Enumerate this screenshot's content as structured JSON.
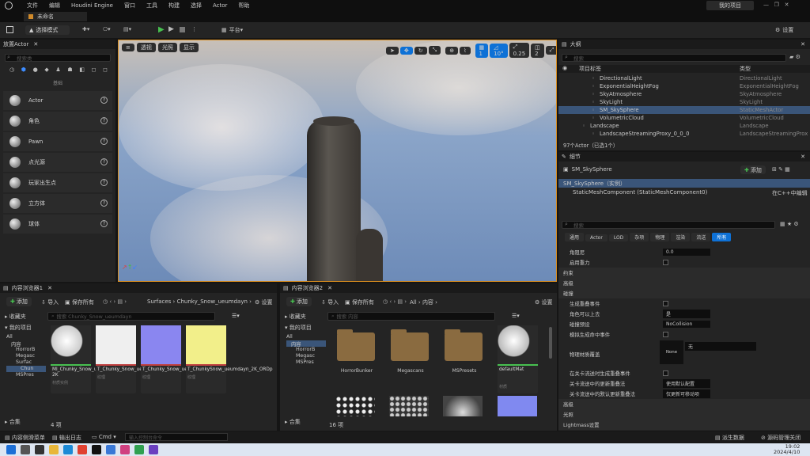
{
  "menu": {
    "items": [
      "文件",
      "编辑",
      "Houdini Engine",
      "窗口",
      "工具",
      "构建",
      "选择",
      "Actor",
      "帮助"
    ],
    "project": "我的项目"
  },
  "tab": {
    "title": "未命名"
  },
  "toolbar": {
    "select_mode": "选择模式",
    "platform": "平台",
    "settings": "设置"
  },
  "place_actor": {
    "title": "放置Actor",
    "search": "搜索类",
    "basic": "基础",
    "items": [
      "Actor",
      "角色",
      "Pawn",
      "点光源",
      "玩家出生点",
      "立方体",
      "球体"
    ]
  },
  "viewport": {
    "btns": [
      "透视",
      "光照",
      "显示"
    ],
    "grid_val": "1",
    "angle_val": "10°",
    "scale_val": "0.25",
    "cam_val": "2"
  },
  "outliner": {
    "title": "大纲",
    "search": "搜索",
    "col_label": "项目标签",
    "col_type": "类型",
    "rows": [
      {
        "name": "DirectionalLight",
        "type": "DirectionalLight"
      },
      {
        "name": "ExponentialHeightFog",
        "type": "ExponentialHeightFog"
      },
      {
        "name": "SkyAtmosphere",
        "type": "SkyAtmosphere"
      },
      {
        "name": "SkyLight",
        "type": "SkyLight"
      },
      {
        "name": "SM_SkySphere",
        "type": "StaticMeshActor"
      },
      {
        "name": "VolumetricCloud",
        "type": "VolumetricCloud"
      },
      {
        "name": "Landscape",
        "type": "Landscape"
      },
      {
        "name": "LandscapeStreamingProxy_0_0_0",
        "type": "LandscapeStreamingProx"
      }
    ],
    "count": "97个Actor（已选1个）"
  },
  "details": {
    "title": "细节",
    "actor": "SM_SkySphere",
    "add": "添加",
    "inst": "SM_SkySphere（实例）",
    "comp": "StaticMeshComponent (StaticMeshComponent0)",
    "edit_cpp": "在C++中编辑",
    "search": "搜索",
    "filters": [
      "通用",
      "Actor",
      "LOD",
      "杂项",
      "物理",
      "渲染",
      "流送",
      "所有"
    ],
    "rows": [
      {
        "l": "角阻尼",
        "v": "0.0"
      },
      {
        "l": "启用重力",
        "v": ""
      },
      {
        "l": "约束",
        "v": ""
      },
      {
        "l": "高级",
        "v": ""
      },
      {
        "l": "碰撞",
        "v": ""
      },
      {
        "l": "生成重叠事件",
        "v": ""
      },
      {
        "l": "角色可以上去",
        "v": "是"
      },
      {
        "l": "碰撞预设",
        "v": "NoCollision"
      },
      {
        "l": "模拟生成命中事件",
        "v": ""
      },
      {
        "l": "物理材质覆盖",
        "v": "无"
      },
      {
        "l": "在关卡流送时生成重叠事件",
        "v": ""
      },
      {
        "l": "关卡流送中的更新重叠法",
        "v": "使用默认配置"
      },
      {
        "l": "关卡流送中的默认更新重叠法",
        "v": "仅更新可移动项"
      },
      {
        "l": "高级",
        "v": ""
      },
      {
        "l": "光照",
        "v": ""
      },
      {
        "l": "Lightmass设置",
        "v": ""
      }
    ],
    "none_label": "None"
  },
  "cb1": {
    "title": "内容浏览器1",
    "add": "添加",
    "import": "导入",
    "save": "保存所有",
    "path": [
      "Surfaces",
      "Chunky_Snow_ueumdayn"
    ],
    "settings": "设置",
    "favorites": "收藏夹",
    "project": "我的项目",
    "search": "搜索 Chunky_Snow_ueumdayn",
    "tree": [
      "All",
      "内容",
      "HorrorB",
      "Megasc",
      "Surfac",
      "Chun",
      "MSPres"
    ],
    "assets": [
      {
        "n": "MI_Chunky_Snow_ueumda 2K",
        "t": "材质实例"
      },
      {
        "n": "T_Chunky_Snow_ueumdayn_2K_D",
        "t": "纹理"
      },
      {
        "n": "T_Chunky_Snow_ueumdayn_2K_N",
        "t": "纹理"
      },
      {
        "n": "T_ChunkySnow_ueumdayn_2K_ORDp",
        "t": "纹理"
      }
    ],
    "count": "4 项",
    "collections": "合集"
  },
  "cb2": {
    "title": "内容浏览器2",
    "add": "添加",
    "import": "导入",
    "save": "保存所有",
    "path": [
      "All",
      "内容"
    ],
    "settings": "设置",
    "favorites": "收藏夹",
    "project": "我的项目",
    "search": "搜索 内容",
    "tree": [
      "All",
      "内容",
      "HorrorB",
      "Megasc",
      "MSPres"
    ],
    "folders": [
      "HorrorBunker",
      "Megascans",
      "MSPresets"
    ],
    "mat": {
      "n": "defaultMat",
      "t": "材质"
    },
    "count": "16 项",
    "collections": "合集"
  },
  "status": {
    "drawer": "内容侧滑菜单",
    "log": "输出日志",
    "cmd": "Cmd",
    "cmd_ph": "输入控制台命令",
    "derived": "派生数据",
    "scm": "源码管理关闭"
  },
  "taskbar": {
    "time": "19:02",
    "date": "2024/4/10"
  }
}
